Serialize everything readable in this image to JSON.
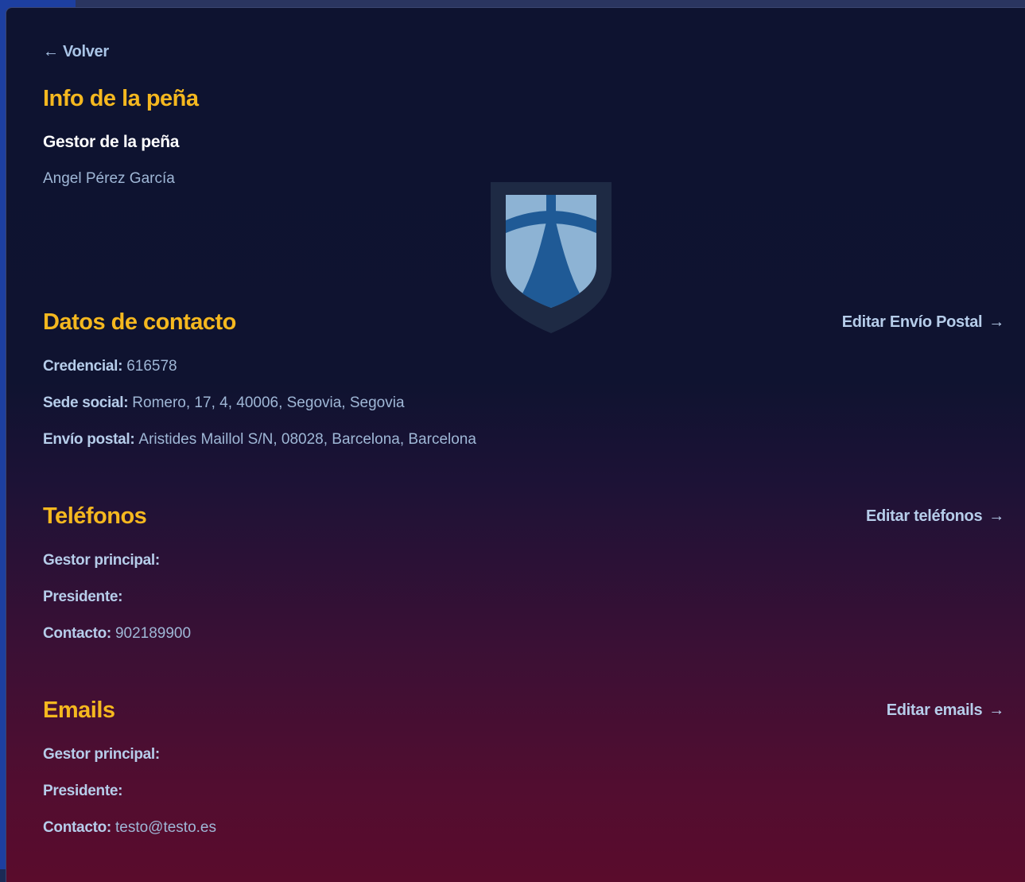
{
  "nav": {
    "back_arrow": "←",
    "back_label": "Volver"
  },
  "info": {
    "title": "Info de la peña",
    "manager_heading": "Gestor de la peña",
    "manager_name": "Angel Pérez García"
  },
  "crest": {
    "icon": "club-shield-crest-icon",
    "colors": {
      "outer": "#1e2a44",
      "light": "#8db3d4",
      "dark": "#1f5a96"
    }
  },
  "contact": {
    "title": "Datos de contacto",
    "edit_label": "Editar Envío Postal",
    "edit_arrow": "→",
    "rows": [
      {
        "label": "Credencial:",
        "value": "616578"
      },
      {
        "label": "Sede social:",
        "value": "Romero, 17, 4, 40006, Segovia, Segovia"
      },
      {
        "label": "Envío postal:",
        "value": "Aristides Maillol S/N, 08028, Barcelona, Barcelona"
      }
    ]
  },
  "phones": {
    "title": "Teléfonos",
    "edit_label": "Editar teléfonos",
    "edit_arrow": "→",
    "rows": [
      {
        "label": "Gestor principal:",
        "value": ""
      },
      {
        "label": "Presidente:",
        "value": ""
      },
      {
        "label": "Contacto:",
        "value": "902189900"
      }
    ]
  },
  "emails": {
    "title": "Emails",
    "edit_label": "Editar emails",
    "edit_arrow": "→",
    "rows": [
      {
        "label": "Gestor principal:",
        "value": ""
      },
      {
        "label": "Presidente:",
        "value": ""
      },
      {
        "label": "Contacto:",
        "value": "testo@testo.es"
      }
    ]
  },
  "theme": {
    "accent": "#f5b81f",
    "label_color": "#b6cdea",
    "value_color": "#9fb7d6"
  }
}
